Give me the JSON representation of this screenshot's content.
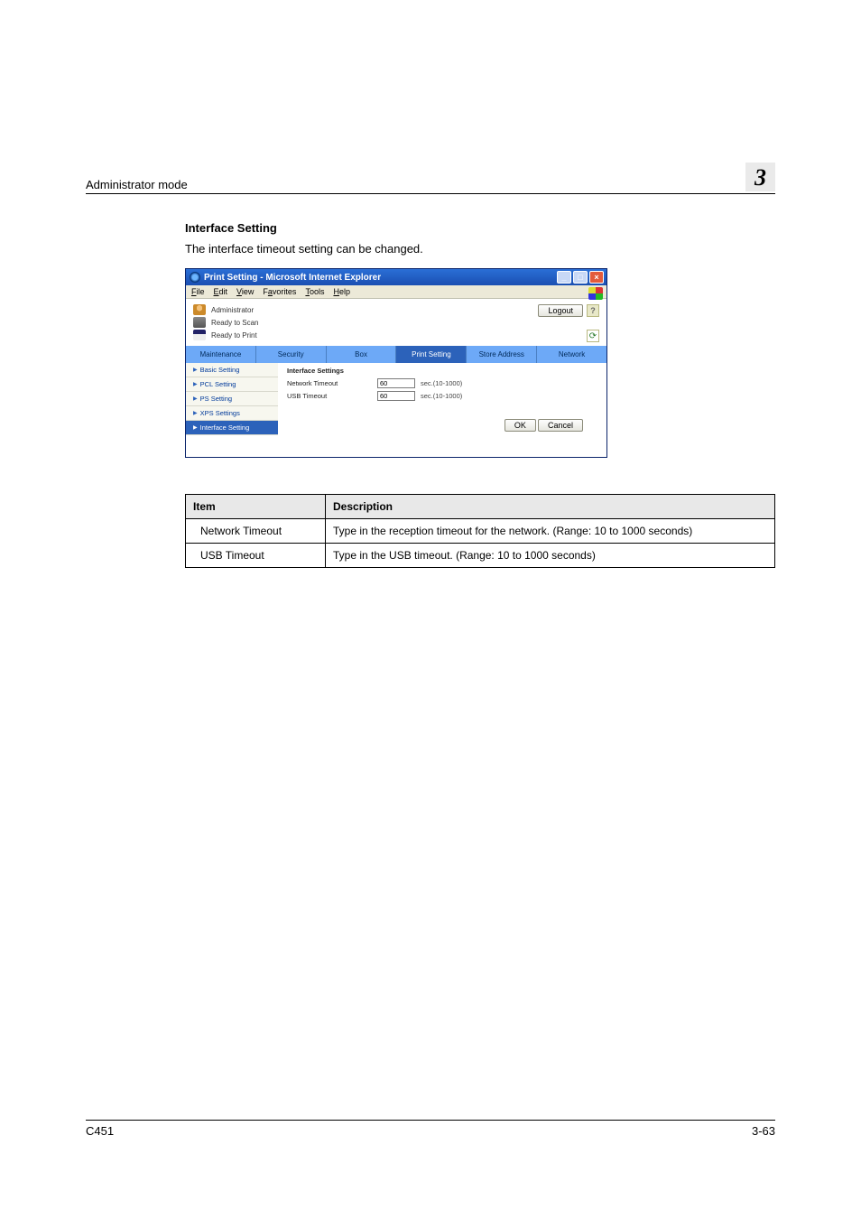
{
  "header": {
    "chapter_label": "Administrator mode",
    "chapter_number": "3"
  },
  "section": {
    "title": "Interface Setting",
    "intro": "The interface timeout setting can be changed."
  },
  "browser": {
    "title": "Print Setting - Microsoft Internet Explorer",
    "menus": [
      "File",
      "Edit",
      "View",
      "Favorites",
      "Tools",
      "Help"
    ],
    "admin_label": "Administrator",
    "status_scan": "Ready to Scan",
    "status_print": "Ready to Print",
    "logout": "Logout",
    "help": "?",
    "refresh": "⟳",
    "tabs": [
      "Maintenance",
      "Security",
      "Box",
      "Print Setting",
      "Store Address",
      "Network"
    ],
    "active_tab_index": 3,
    "sidebar": [
      {
        "label": "Basic Setting"
      },
      {
        "label": "PCL Setting"
      },
      {
        "label": "PS Setting"
      },
      {
        "label": "XPS Settings"
      },
      {
        "label": "Interface Setting"
      }
    ],
    "active_sidebar_index": 4,
    "form": {
      "title": "Interface Settings",
      "rows": [
        {
          "label": "Network Timeout",
          "value": "60",
          "unit": "sec.(10-1000)"
        },
        {
          "label": "USB Timeout",
          "value": "60",
          "unit": "sec.(10-1000)"
        }
      ],
      "ok": "OK",
      "cancel": "Cancel"
    }
  },
  "table": {
    "head": [
      "Item",
      "Description"
    ],
    "rows": [
      {
        "item": "Network Timeout",
        "desc": "Type in the reception timeout for the network. (Range: 10 to 1000 seconds)"
      },
      {
        "item": "USB Timeout",
        "desc": "Type in the USB timeout. (Range: 10 to 1000 seconds)"
      }
    ]
  },
  "footer": {
    "left": "C451",
    "right": "3-63"
  }
}
